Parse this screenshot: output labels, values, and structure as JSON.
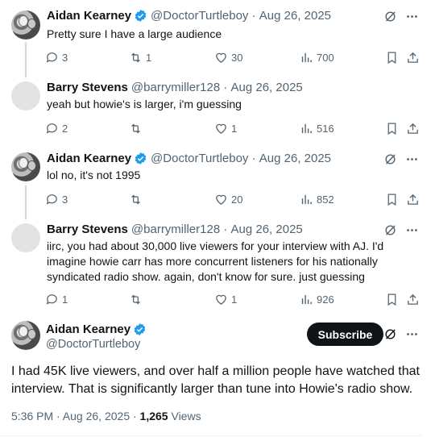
{
  "tweets": [
    {
      "name": "Aidan Kearney",
      "handle": "@DoctorTurtleboy",
      "date": "Aug 26, 2025",
      "text": "Pretty sure I have a large audience",
      "replies": "3",
      "retweets": "1",
      "likes": "30",
      "views": "700"
    },
    {
      "name": "Barry Stevens",
      "handle": "@barrymiller128",
      "date": "Aug 26, 2025",
      "text": "yeah but howie's is larger, i'm guessing",
      "replies": "2",
      "retweets": "",
      "likes": "1",
      "views": "516"
    },
    {
      "name": "Aidan Kearney",
      "handle": "@DoctorTurtleboy",
      "date": "Aug 26, 2025",
      "text": "lol no, it's not 1995",
      "replies": "3",
      "retweets": "",
      "likes": "20",
      "views": "852"
    },
    {
      "name": "Barry Stevens",
      "handle": "@barrymiller128",
      "date": "Aug 26, 2025",
      "text": "iirc, you had about 30,000 live viewers for your interview with AJ.  I'd imagine howie carr has more concurrent listeners for his nationally syndicated radio show. again, don't know for sure. just guessing",
      "replies": "1",
      "retweets": "",
      "likes": "1",
      "views": "926"
    }
  ],
  "main_tweet": {
    "name": "Aidan Kearney",
    "handle": "@DoctorTurtleboy",
    "subscribe_label": "Subscribe",
    "text": "I had 45K live viewers, and over half a million people have watched that interview. That is significantly larger than tune into Howie's radio show.",
    "time": "5:36 PM · Aug 26, 2025 · ",
    "views_count": "1,265",
    "views_label": " Views"
  },
  "separator": " · ",
  "colors": {
    "verified": "#1d9bf0",
    "muted": "#536471",
    "text": "#0f1419"
  }
}
